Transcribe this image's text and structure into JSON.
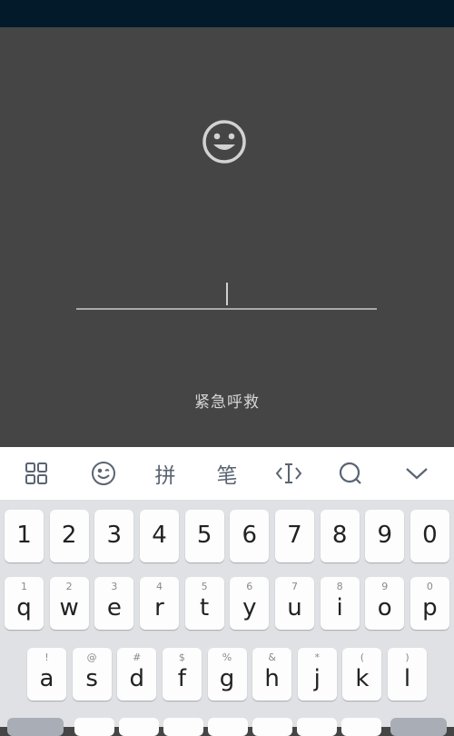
{
  "lock_screen": {
    "emergency_label": "紧急呼救"
  },
  "toolbar": {
    "items": [
      {
        "name": "grid-icon",
        "label": ""
      },
      {
        "name": "emoji-icon",
        "label": ""
      },
      {
        "name": "pinyin-button",
        "label": "拼"
      },
      {
        "name": "stroke-button",
        "label": "笔"
      },
      {
        "name": "cursor-icon",
        "label": ""
      },
      {
        "name": "search-icon",
        "label": ""
      },
      {
        "name": "collapse-icon",
        "label": ""
      }
    ]
  },
  "keyboard": {
    "number_row": [
      "1",
      "2",
      "3",
      "4",
      "5",
      "6",
      "7",
      "8",
      "9",
      "0"
    ],
    "letter_row1": [
      {
        "main": "q",
        "sub": "1"
      },
      {
        "main": "w",
        "sub": "2"
      },
      {
        "main": "e",
        "sub": "3"
      },
      {
        "main": "r",
        "sub": "4"
      },
      {
        "main": "t",
        "sub": "5"
      },
      {
        "main": "y",
        "sub": "6"
      },
      {
        "main": "u",
        "sub": "7"
      },
      {
        "main": "i",
        "sub": "8"
      },
      {
        "main": "o",
        "sub": "9"
      },
      {
        "main": "p",
        "sub": "0"
      }
    ],
    "letter_row2": [
      {
        "main": "a",
        "sub": "!"
      },
      {
        "main": "s",
        "sub": "@"
      },
      {
        "main": "d",
        "sub": "#"
      },
      {
        "main": "f",
        "sub": "$"
      },
      {
        "main": "g",
        "sub": "%"
      },
      {
        "main": "h",
        "sub": "&"
      },
      {
        "main": "j",
        "sub": "*"
      },
      {
        "main": "k",
        "sub": "("
      },
      {
        "main": "l",
        "sub": ")"
      }
    ]
  },
  "colors": {
    "status_bar": "#031a2b",
    "lock_background": "#454545",
    "keyboard_background": "#dfe1e5",
    "key": "#fdfdfd"
  }
}
